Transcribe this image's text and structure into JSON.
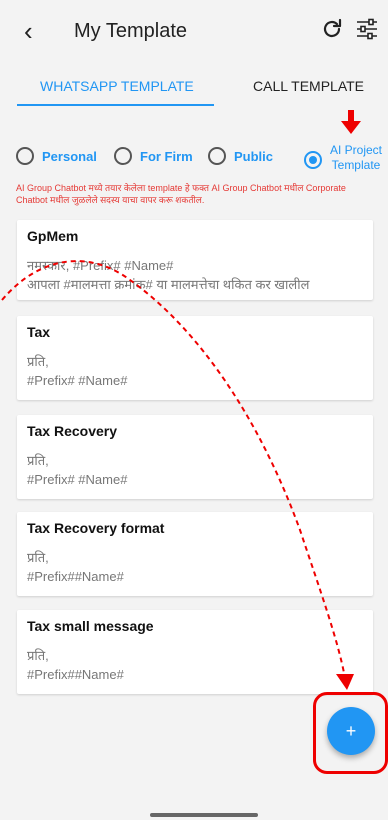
{
  "header": {
    "back_icon": "chevron-left-icon",
    "back_glyph": "‹",
    "title": "My Template",
    "refresh_icon": "refresh-icon",
    "filter_icon": "sliders-icon"
  },
  "tabs": [
    {
      "label": "WHATSAPP TEMPLATE",
      "active": true
    },
    {
      "label": "CALL TEMPLATE",
      "active": false
    }
  ],
  "radios": [
    {
      "label": "Personal",
      "selected": false
    },
    {
      "label": "For Firm",
      "selected": false
    },
    {
      "label": "Public",
      "selected": false
    },
    {
      "label_line1": "AI Project",
      "label_line2": "Template",
      "selected": true
    }
  ],
  "notice": "AI Group Chatbot मध्ये तयार केलेला template हे फक्त AI Group Chatbot मधील Corporate Chatbot मधील जुळलेले सदस्य याचा वापर करू शकतील.",
  "templates": [
    {
      "title": "GpMem",
      "line1": "नमस्कार, #Prefix#  #Name#",
      "line2": "आपला #मालमत्ता क्रमांक# या मालमत्तेचा थकित कर खालील"
    },
    {
      "title": "Tax",
      "line1": "प्रति,",
      "line2": "#Prefix# #Name#"
    },
    {
      "title": "Tax Recovery",
      "line1": "प्रति,",
      "line2": "#Prefix# #Name#"
    },
    {
      "title": "Tax Recovery format",
      "line1": "प्रति,",
      "line2": "#Prefix##Name#"
    },
    {
      "title": "Tax small message",
      "line1": "प्रति,",
      "line2": "#Prefix##Name#"
    }
  ],
  "fab": {
    "label": "+",
    "icon": "plus-icon"
  },
  "colors": {
    "accent": "#2196f3",
    "annotation": "#e00000",
    "notice": "#e53935"
  }
}
